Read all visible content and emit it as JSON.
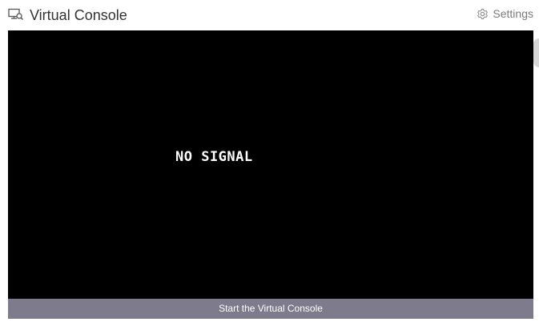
{
  "header": {
    "title": "Virtual Console",
    "title_icon": "monitor-search-icon",
    "settings_label": "Settings",
    "settings_icon": "gear-icon"
  },
  "console": {
    "message": "NO SIGNAL",
    "start_label": "Start the Virtual Console"
  },
  "colors": {
    "screen": "#000000",
    "start_bar": "#7d7b8c",
    "title_text": "#333333",
    "settings_text": "#7a7a7a"
  }
}
